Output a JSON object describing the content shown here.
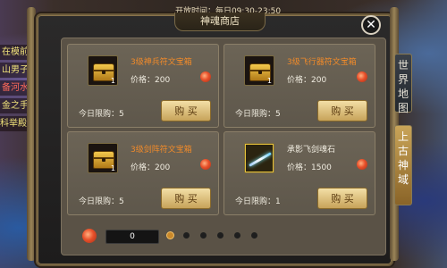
{
  "topbar": {
    "open_time": "开放时间：每日09:30-23:50"
  },
  "title": "神魂商店",
  "left_labels": [
    {
      "text": "在模前",
      "red": false
    },
    {
      "text": "山男子",
      "red": false
    },
    {
      "text": "备河水",
      "red": true
    },
    {
      "text": "金之手",
      "red": false
    },
    {
      "text": "科举殿说",
      "red": false
    }
  ],
  "items": [
    {
      "name": "3级神兵符文宝箱",
      "price_label": "价格：200",
      "limit_label": "今日限购：5",
      "buy_label": "购 买",
      "qty": "1",
      "icon": "treasure-chest-icon",
      "name_color": "orange"
    },
    {
      "name": "3级飞行器符文宝箱",
      "price_label": "价格：200",
      "limit_label": "今日限购：5",
      "buy_label": "购 买",
      "qty": "1",
      "icon": "treasure-chest-icon",
      "name_color": "orange"
    },
    {
      "name": "3级剑阵符文宝箱",
      "price_label": "价格：200",
      "limit_label": "今日限购：5",
      "buy_label": "购 买",
      "qty": "1",
      "icon": "treasure-chest-icon",
      "name_color": "orange"
    },
    {
      "name": "承影飞剑魂石",
      "price_label": "价格：1500",
      "limit_label": "今日限购：1",
      "buy_label": "购 买",
      "qty": "",
      "icon": "flying-sword-icon",
      "name_color": "white"
    }
  ],
  "footer": {
    "currency_amount": "0",
    "page_count": 6,
    "active_page": 1
  },
  "side_tabs": [
    {
      "label": "世界地图",
      "active": false
    },
    {
      "label": "上古神域",
      "active": true
    }
  ],
  "colors": {
    "item_name": "#f08a2a",
    "buy_button": "#e0c27a",
    "currency": "#e8502a"
  }
}
